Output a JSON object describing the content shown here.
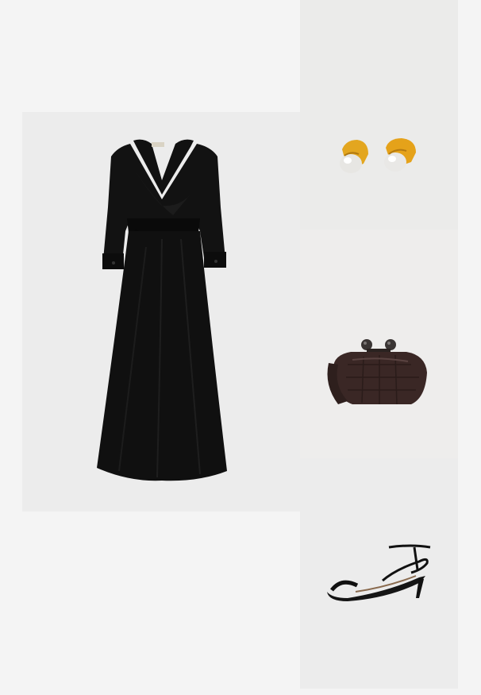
{
  "board": {
    "background": "#f4f4f4",
    "items": [
      {
        "key": "dress",
        "color": "#0d0d0d"
      },
      {
        "key": "earrings",
        "color": "#e1a21c"
      },
      {
        "key": "bag",
        "color": "#3a2725"
      },
      {
        "key": "sandals",
        "color": "#111111"
      }
    ]
  }
}
